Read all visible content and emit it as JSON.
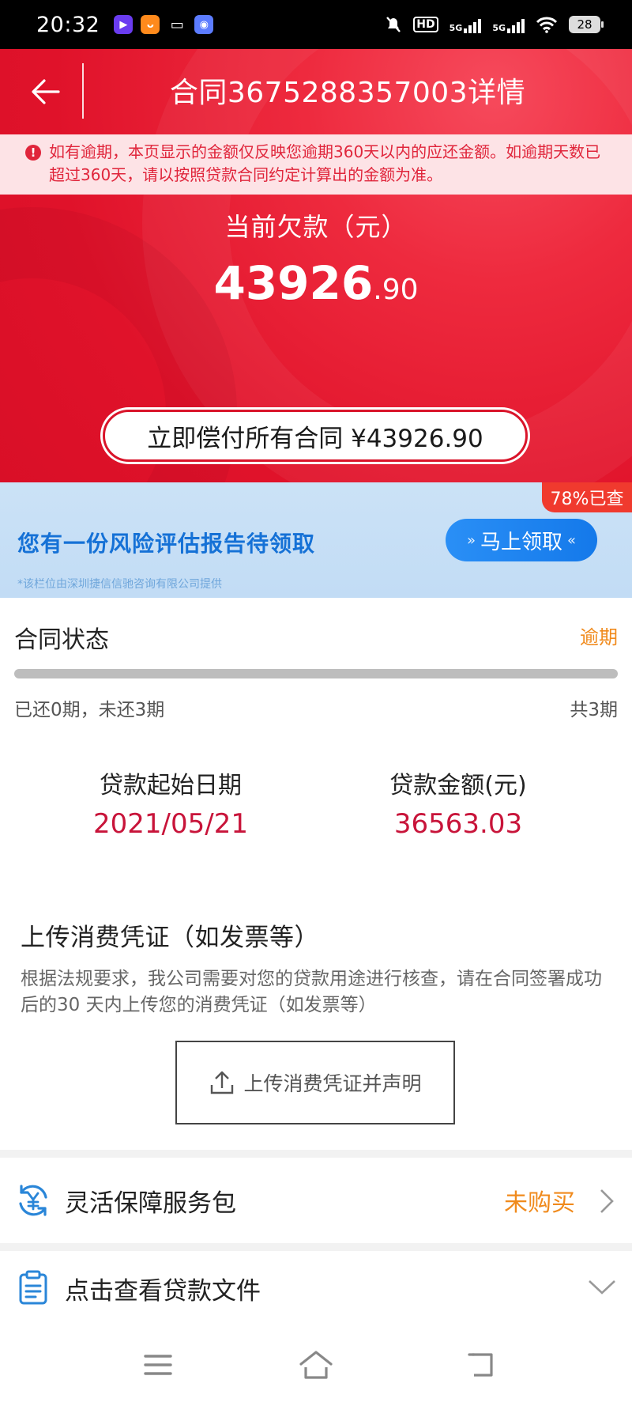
{
  "status_bar": {
    "time": "20:32",
    "network_labels": [
      "HD",
      "5G",
      "5G"
    ],
    "battery": "28"
  },
  "header": {
    "title": "合同3675288357003详情",
    "back_icon": "arrow-left-icon"
  },
  "notice": {
    "text": "如有逾期，本页显示的金额仅反映您逾期360天以内的应还金额。如逾期天数已超过360天，请以按照贷款合同约定计算出的金额为准。",
    "icon": "exclamation-icon"
  },
  "debt": {
    "label": "当前欠款（元）",
    "amount_int": "43926",
    "amount_dec": ".90",
    "pay_all_label": "立即偿付所有合同 ¥43926.90"
  },
  "ad": {
    "tag": "78%已查",
    "title": "您有一份风险评估报告待领取",
    "button_label": "马上领取",
    "footnote": "*该栏位由深圳捷信信驰咨询有限公司提供"
  },
  "contract_status": {
    "title": "合同状态",
    "status": "逾期",
    "paid_periods": 0,
    "total_periods": 3,
    "progress_fraction": 0,
    "periods_text": "已还0期，未还3期",
    "total_text": "共3期"
  },
  "loan_info": {
    "start_date_label": "贷款起始日期",
    "start_date": "2021/05/21",
    "amount_label": "贷款金额(元)",
    "amount": "36563.03"
  },
  "upload": {
    "title": "上传消费凭证（如发票等）",
    "description": "根据法规要求，我公司需要对您的贷款用途进行核查，请在合同签署成功后的30 天内上传您的消费凭证（如发票等）",
    "button_label": "上传消费凭证并声明",
    "icon": "upload-icon"
  },
  "service_package": {
    "label": "灵活保障服务包",
    "value": "未购买",
    "icon": "yuan-refresh-icon"
  },
  "loan_documents": {
    "label": "点击查看贷款文件",
    "icon": "clipboard-icon"
  },
  "colors": {
    "brand_red": "#e0122a",
    "overdue_orange": "#f08a1c",
    "ad_blue": "#1571d6",
    "amount_red": "#c8143a"
  }
}
